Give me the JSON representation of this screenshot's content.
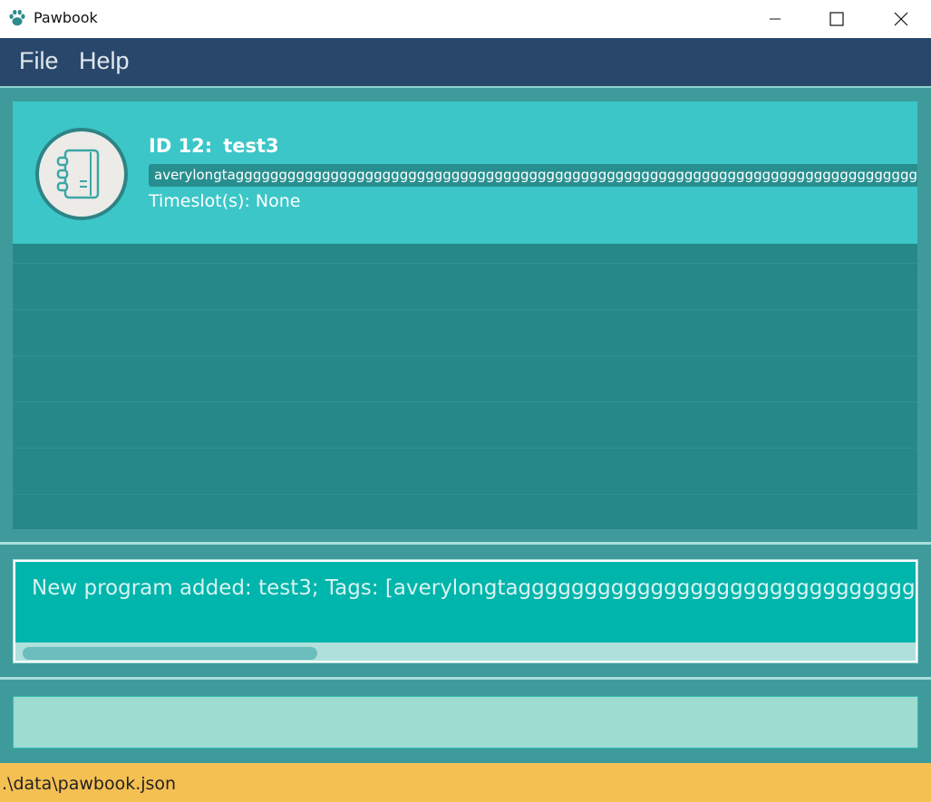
{
  "window": {
    "title": "Pawbook",
    "icon": "paw-icon",
    "controls": [
      "minimize-icon",
      "maximize-icon",
      "close-icon"
    ]
  },
  "menu": {
    "items": [
      "File",
      "Help"
    ]
  },
  "program_list": {
    "cards": [
      {
        "id_label": "ID 12:",
        "name": "test3",
        "tag": "averylongtaggggggggggggggggggggggggggggggggggggggggggggggggggggggggggggggggggggggggggggggggg",
        "timeslot": "Timeslot(s): None",
        "icon": "notebook-icon"
      }
    ]
  },
  "result_display": {
    "text": "New program added: test3; Tags: [averylongtagggggggggggggggggggggggggggggggggg"
  },
  "command_box": {
    "value": "",
    "placeholder": ""
  },
  "status_bar": {
    "save_path": ".\\data\\pawbook.json"
  },
  "colors": {
    "menu_bar": "#29476a",
    "background": "#3f9b9b",
    "list_bg": "#278888",
    "card_bg": "#3cc6c8",
    "tag_bg": "#288f90",
    "result_bg": "#00b5ab",
    "command_bg": "#9edbd0",
    "status_bar": "#f5c052"
  }
}
